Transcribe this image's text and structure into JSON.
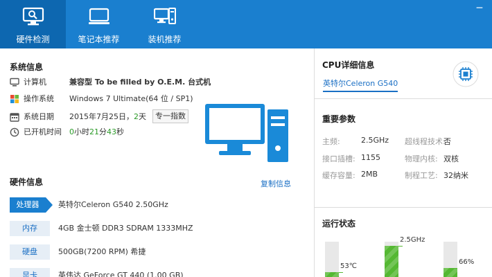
{
  "tabs": [
    {
      "label": "硬件检测",
      "icon": "monitor-check-icon",
      "active": true
    },
    {
      "label": "笔记本推荐",
      "icon": "laptop-icon",
      "active": false
    },
    {
      "label": "装机推荐",
      "icon": "desktop-pc-icon",
      "active": false
    }
  ],
  "window": {
    "minimize": "─"
  },
  "system_info": {
    "title": "系统信息",
    "rows": [
      {
        "label": "计算机",
        "value": "兼容型 To be filled by O.E.M. 台式机",
        "icon": "computer-icon"
      },
      {
        "label": "操作系统",
        "value": "Windows 7 Ultimate(64 位 / SP1)",
        "icon": "windows-icon"
      },
      {
        "label": "系统日期",
        "value": "2015年7月25日，",
        "value_extra": "2",
        "value_suffix": "天",
        "icon": "calendar-icon"
      },
      {
        "label": "已开机时间",
        "v_h": "0",
        "u_h": "小时",
        "v_m": "21",
        "u_m": "分",
        "v_s": "43",
        "u_s": "秒",
        "icon": "clock-icon"
      }
    ],
    "score_button": "专一指数"
  },
  "hardware_info": {
    "title": "硬件信息",
    "copy_link": "复制信息",
    "rows": [
      {
        "badge": "处理器",
        "value": "英特尔Celeron G540 2.50GHz",
        "active": true
      },
      {
        "badge": "内存",
        "value": "4GB 金士顿 DDR3 SDRAM 1333MHZ",
        "active": false
      },
      {
        "badge": "硬盘",
        "value": "500GB(7200 RPM) 希捷",
        "active": false
      },
      {
        "badge": "显卡",
        "value": "英伟达 GeForce GT 440 (1.00 GB)",
        "active": false
      }
    ]
  },
  "cpu_detail": {
    "title": "CPU详细信息",
    "cpu_link": "英特尔Celeron G540",
    "icon": "cpu-chip-icon"
  },
  "params": {
    "title": "重要参数",
    "items": [
      {
        "label": "主频:",
        "value": "2.5GHz"
      },
      {
        "label": "超线程技术:",
        "value": "否"
      },
      {
        "label": "接口插槽:",
        "value": "1155"
      },
      {
        "label": "物理内核:",
        "value": "双核"
      },
      {
        "label": "缓存容量:",
        "value": "2MB"
      },
      {
        "label": "制程工艺:",
        "value": "32纳米"
      }
    ]
  },
  "status": {
    "title": "运行状态",
    "bars": [
      {
        "label": "53℃",
        "level": 0.6
      },
      {
        "label": "2.5GHz",
        "level": 0.95
      },
      {
        "label": "66%",
        "level": 0.66
      }
    ]
  },
  "colors": {
    "accent": "#1a7fcf",
    "green": "#55b833",
    "link": "#1a6fc4"
  }
}
